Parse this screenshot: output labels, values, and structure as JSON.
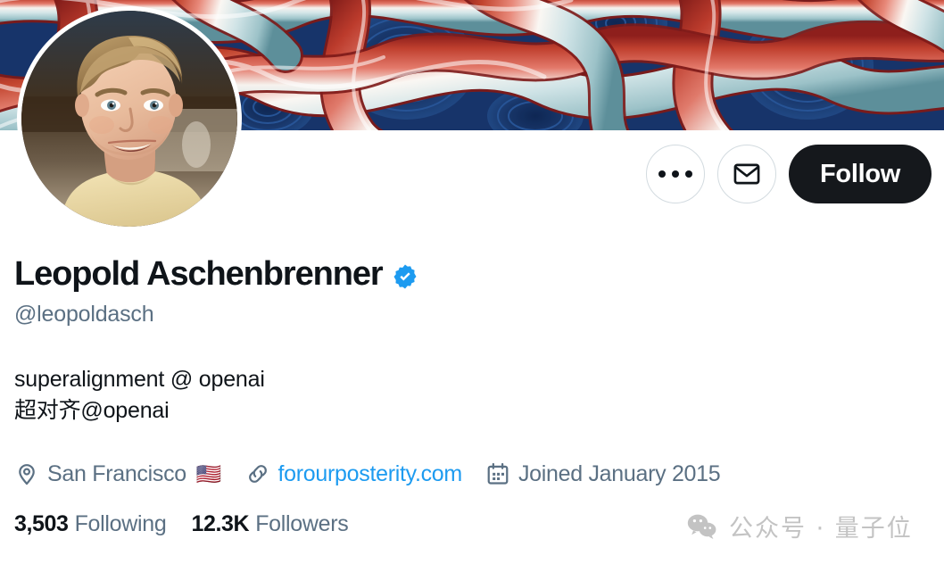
{
  "profile": {
    "display_name": "Leopold Aschenbrenner",
    "handle": "@leopoldasch",
    "verified": true,
    "bio_lines": [
      "superalignment @ openai",
      "超对齐@openai"
    ],
    "location": "San Francisco",
    "location_flag": "🇺🇸",
    "website": "forourposterity.com",
    "joined": "Joined January 2015"
  },
  "actions": {
    "more_label": "more-options",
    "message_label": "message",
    "follow_label": "Follow"
  },
  "stats": [
    {
      "value": "3,503",
      "label": "Following"
    },
    {
      "value": "12.3K",
      "label": "Followers"
    }
  ],
  "watermark": {
    "text": "公众号 · 量子位"
  },
  "colors": {
    "accent_blue": "#1d9bf0",
    "verified_blue": "#1d9bf0",
    "follow_bg": "#15181c",
    "text_primary": "#0f1419",
    "text_secondary": "#5b7083",
    "banner_navy": "#1b3a6e",
    "banner_red": "#b9372f",
    "banner_lightblue": "#bcd9dd"
  }
}
